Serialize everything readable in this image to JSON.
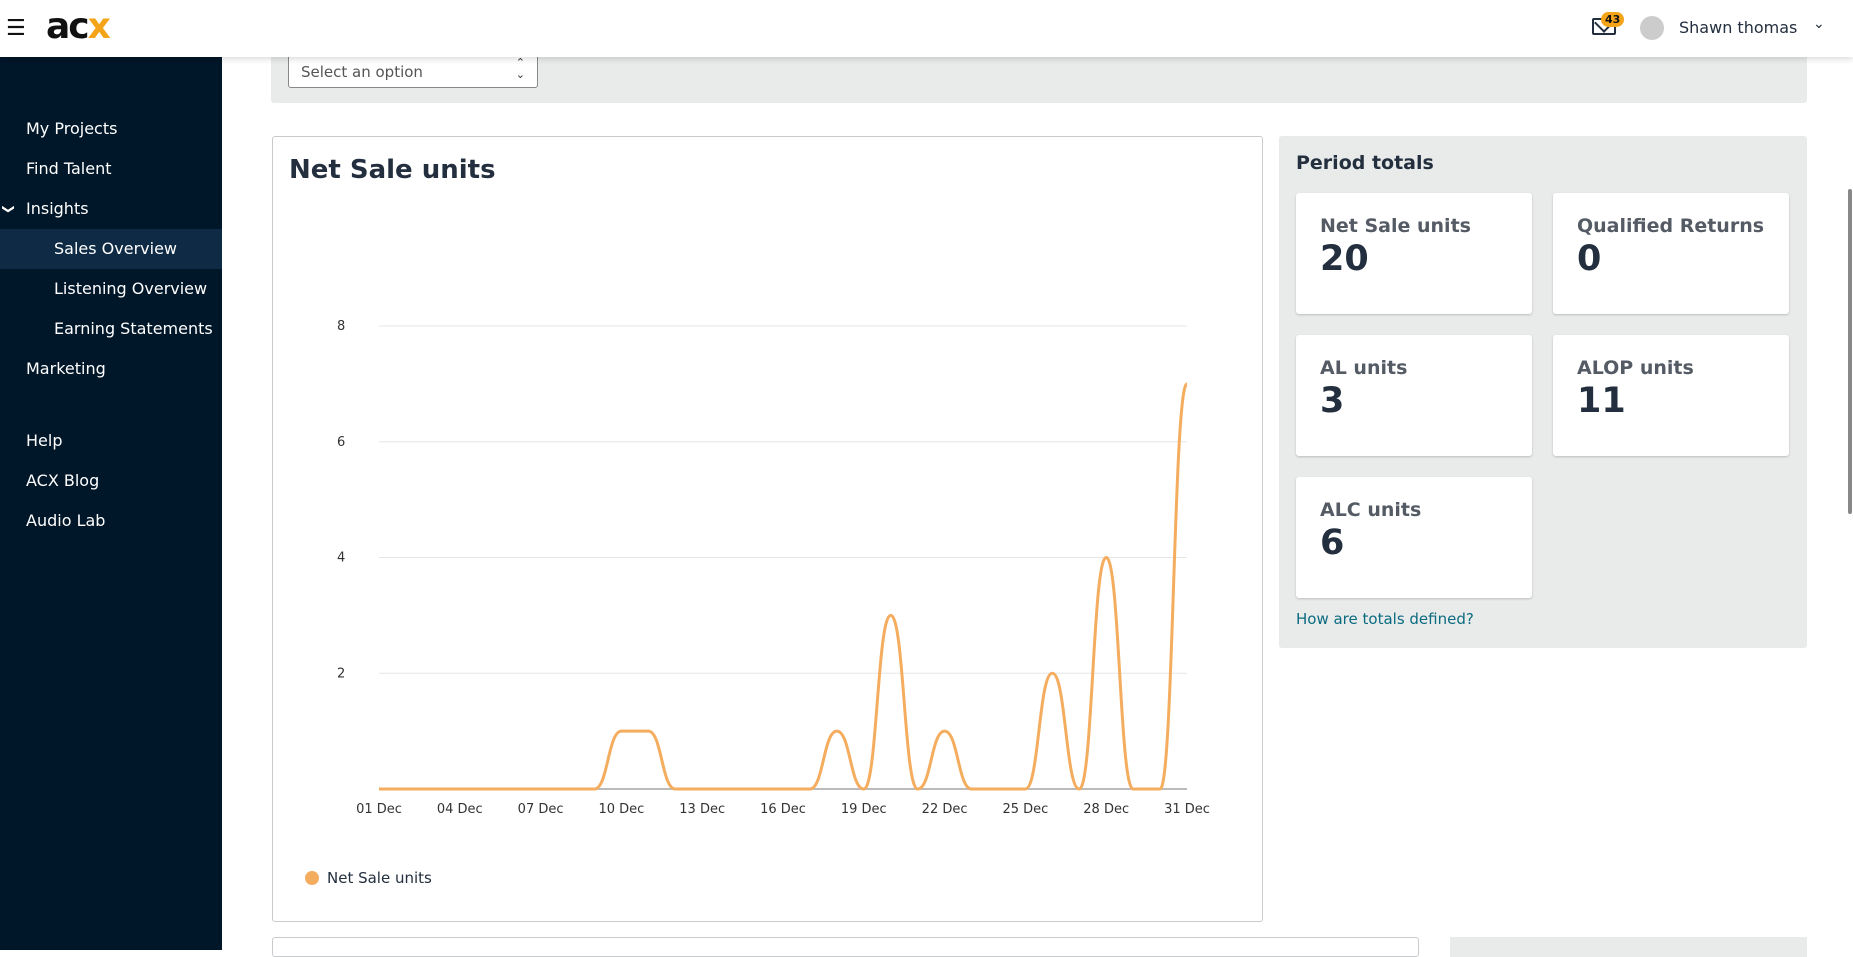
{
  "header": {
    "logo": "acx",
    "notifications": "43",
    "user": "Shawn thomas"
  },
  "sidebar": {
    "items": [
      {
        "label": "My Projects"
      },
      {
        "label": "Find Talent"
      },
      {
        "label": "Insights",
        "expanded": true
      },
      {
        "label": "Sales Overview",
        "active": true
      },
      {
        "label": "Listening Overview"
      },
      {
        "label": "Earning Statements"
      },
      {
        "label": "Marketing"
      },
      {
        "label": "Help"
      },
      {
        "label": "ACX Blog"
      },
      {
        "label": "Audio Lab"
      }
    ]
  },
  "filter": {
    "placeholder": "Select an option"
  },
  "chart_title": "Net Sale units",
  "chart_data": {
    "type": "line",
    "title": "Net Sale units",
    "x": [
      "01 Dec",
      "02 Dec",
      "03 Dec",
      "04 Dec",
      "05 Dec",
      "06 Dec",
      "07 Dec",
      "08 Dec",
      "09 Dec",
      "10 Dec",
      "11 Dec",
      "12 Dec",
      "13 Dec",
      "14 Dec",
      "15 Dec",
      "16 Dec",
      "17 Dec",
      "18 Dec",
      "19 Dec",
      "20 Dec",
      "21 Dec",
      "22 Dec",
      "23 Dec",
      "24 Dec",
      "25 Dec",
      "26 Dec",
      "27 Dec",
      "28 Dec",
      "29 Dec",
      "30 Dec",
      "31 Dec"
    ],
    "xticks": [
      "01 Dec",
      "04 Dec",
      "07 Dec",
      "10 Dec",
      "13 Dec",
      "16 Dec",
      "19 Dec",
      "22 Dec",
      "25 Dec",
      "28 Dec",
      "31 Dec"
    ],
    "yticks": [
      "2",
      "4",
      "6",
      "8"
    ],
    "series": [
      {
        "name": "Net Sale units",
        "color": "#f4ad5f",
        "values": [
          0,
          0,
          0,
          0,
          0,
          0,
          0,
          0,
          0,
          1,
          1,
          0,
          0,
          0,
          0,
          0,
          0,
          1,
          0,
          3,
          0,
          1,
          0,
          0,
          0,
          2,
          0,
          4,
          0,
          0,
          7
        ]
      }
    ],
    "ylim": [
      0,
      8
    ],
    "grid": true,
    "legend": "bottom-left"
  },
  "totals": {
    "title": "Period totals",
    "cards": [
      {
        "label": "Net Sale units",
        "value": "20"
      },
      {
        "label": "Qualified Returns",
        "value": "0"
      },
      {
        "label": "AL units",
        "value": "3"
      },
      {
        "label": "ALOP units",
        "value": "11"
      },
      {
        "label": "ALC units",
        "value": "6"
      }
    ],
    "link": "How are totals defined?"
  }
}
